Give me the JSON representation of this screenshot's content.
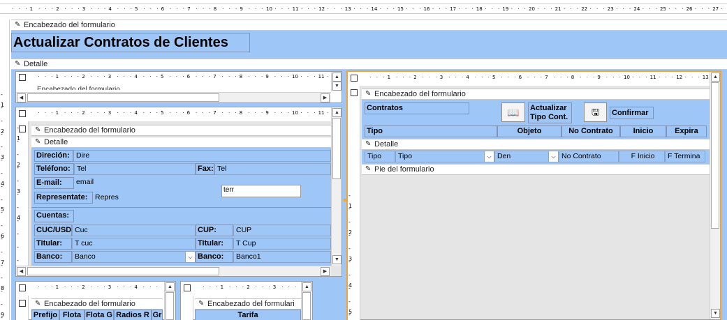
{
  "main_form": {
    "ruler_numbers": [
      "1",
      "2",
      "3",
      "4",
      "5",
      "6",
      "7",
      "8",
      "9",
      "10",
      "11",
      "12",
      "13",
      "14",
      "15",
      "16",
      "17",
      "18",
      "19",
      "20",
      "21",
      "22",
      "23",
      "24",
      "25",
      "26",
      "27"
    ],
    "vruler_numbers": [
      "1",
      "2",
      "3",
      "4",
      "5",
      "6",
      "7",
      "8",
      "9"
    ],
    "header_section": "Encabezado del formulario",
    "title": "Actualizar Contratos de Clientes",
    "detail_section": "Detalle"
  },
  "sub_top_small": {
    "ruler_numbers": [
      "1",
      "2",
      "3",
      "4",
      "5",
      "6",
      "7",
      "8",
      "9",
      "10",
      "11"
    ],
    "header_section_partial": "Encabezado del formulario"
  },
  "sub_client": {
    "ruler_numbers": [
      "1",
      "2",
      "3",
      "4",
      "5",
      "6",
      "7",
      "8",
      "9",
      "10",
      "11"
    ],
    "vruler_numbers": [
      "1",
      "2",
      "3",
      "4"
    ],
    "header_section": "Encabezado del formulario",
    "detail_section": "Detalle",
    "fields": {
      "direccion_label": "Direción:",
      "direccion_value": "Dire",
      "telefono_label": "Teléfono:",
      "telefono_value": "Tel",
      "fax_label": "Fax:",
      "fax_value": "Tel",
      "email_label": "E-mail:",
      "email_value": "email",
      "terr_value": "terr",
      "representante_label": "Representate:",
      "representante_value": "Repres",
      "cuentas_label": "Cuentas:",
      "cuc_label": "CUC/USD:",
      "cuc_value": "Cuc",
      "cup_label": "CUP:",
      "cup_value": "CUP",
      "titular1_label": "Titular:",
      "titular1_value": "T cuc",
      "titular2_label": "Titular:",
      "titular2_value": "T Cup",
      "banco1_label": "Banco:",
      "banco1_value": "Banco",
      "banco2_label": "Banco:",
      "banco2_value": "Banco1"
    }
  },
  "sub_contracts": {
    "ruler_numbers": [
      "1",
      "2",
      "3",
      "4",
      "5",
      "6",
      "7",
      "8",
      "9",
      "10",
      "11",
      "12",
      "13"
    ],
    "vruler_numbers": [
      "1",
      "2",
      "3",
      "4",
      "5"
    ],
    "header_section": "Encabezado del formulario",
    "contratos_label": "Contratos",
    "update_button": "Actualizar Tipo Cont.",
    "confirm_button": "Confirmar",
    "columns": [
      "Tipo",
      "Objeto",
      "No Contrato",
      "Inicio",
      "Expira"
    ],
    "detail_section": "Detalle",
    "row": {
      "tipo_label": "Tipo",
      "tipo_value": "Tipo",
      "objeto_value": "Den",
      "no_contrato": "No Contrato",
      "inicio": "F Inicio",
      "expira": "F Termina"
    },
    "footer_section": "Pie del formulario"
  },
  "sub_bottom_left": {
    "ruler_numbers": [
      "1",
      "2",
      "3",
      "4"
    ],
    "header_section": "Encabezado del formulario",
    "columns": [
      "Prefijo",
      "Flota",
      "Flota G",
      "Radios R",
      "Gr"
    ]
  },
  "sub_bottom_mid": {
    "ruler_numbers": [
      "1",
      "2",
      "3"
    ],
    "header_section": "Encabezado del formulari",
    "column": "Tarifa"
  },
  "colors": {
    "section_blue": "#9ec6f6",
    "selection_orange": "#f2a33a"
  }
}
